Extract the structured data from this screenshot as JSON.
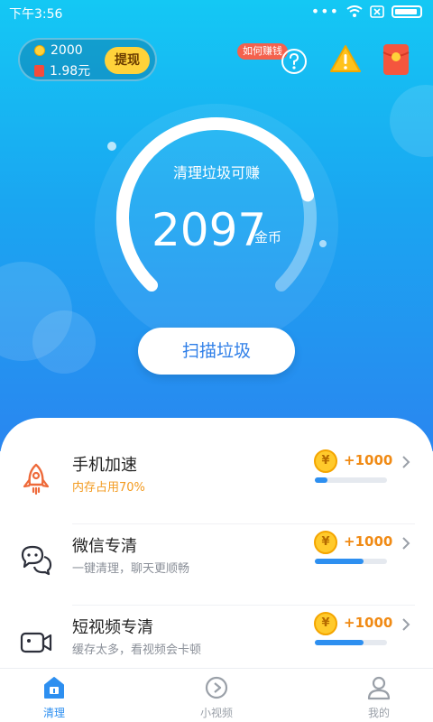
{
  "status_bar": {
    "time": "下午3:56",
    "dots": "•••"
  },
  "wallet": {
    "coins": "2000",
    "cash": "1.98元",
    "withdraw_label": "提现"
  },
  "header": {
    "earn_badge": "如何赚钱",
    "icons": [
      "help-icon",
      "warning-icon",
      "red-envelope-icon"
    ]
  },
  "dial": {
    "title": "清理垃圾可赚",
    "value": "2097",
    "unit": "金币",
    "progress": 0.78
  },
  "scan_button": {
    "label": "扫描垃圾"
  },
  "tasks": [
    {
      "title": "手机加速",
      "subtitle": "内存占用70%",
      "reward": "+1000",
      "progress": 0.18,
      "icon": "rocket-icon",
      "coin_symbol": "¥"
    },
    {
      "title": "微信专清",
      "subtitle": "一键清理，聊天更顺畅",
      "reward": "+1000",
      "progress": 0.68,
      "icon": "chat-bubbles-icon",
      "coin_symbol": "¥"
    },
    {
      "title": "短视频专清",
      "subtitle": "缓存太多，看视频会卡顿",
      "reward": "+1000",
      "progress": 0.68,
      "icon": "video-camera-icon",
      "coin_symbol": "¥"
    }
  ],
  "tabbar": {
    "tabs": [
      {
        "label": "清理",
        "icon": "clean-icon",
        "active": true
      },
      {
        "label": "小视频",
        "icon": "play-icon",
        "active": false
      },
      {
        "label": "我的",
        "icon": "profile-icon",
        "active": false
      }
    ]
  },
  "colors": {
    "accent": "#2d8ff0",
    "reward": "#f08a14",
    "hero_top": "#14c8f4",
    "hero_bottom": "#2a86f0"
  }
}
